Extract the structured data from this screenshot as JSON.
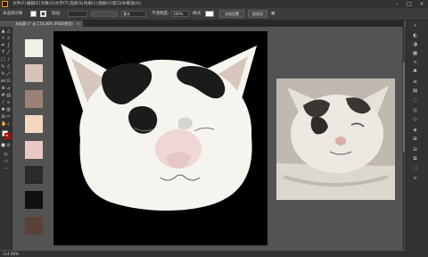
{
  "menubar": {
    "items": [
      "文件(F)",
      "编辑(E)",
      "对象(O)",
      "文字(T)",
      "选择(S)",
      "效果(C)",
      "视图(V)",
      "窗口(W)",
      "帮助(H)"
    ]
  },
  "control_bar": {
    "path_label": "未选择对象",
    "stroke_label": "描边:",
    "basic_label": "基本",
    "opacity_label": "不透明度:",
    "opacity_value": "100%",
    "style_label": "样式:",
    "doc_setup_label": "文档设置",
    "prefs_label": "首选项"
  },
  "document_tab": {
    "label": "未标题-1* @ 114.46% (RGB/预览)",
    "close": "×"
  },
  "status_bar": {
    "zoom": "114.46%"
  },
  "colors": {
    "swatches": [
      "#f2efe9",
      "#d8c3b7",
      "#9b8276",
      "#f3d8bd",
      "#e8c7c4",
      "#2a2a2a",
      "#111111",
      "#5a4236"
    ],
    "cat_face": "#f6f4ee",
    "cat_patch": "#1b1b1b",
    "ear_inner": "#d7c6bc",
    "blush": "#e9c0c4",
    "nose": "#e6c7c9"
  },
  "icons": {
    "tools": [
      "select-icon",
      "direct-select-icon",
      "magic-wand-icon",
      "pen-icon",
      "type-icon",
      "line-icon",
      "rectangle-icon",
      "brush-icon",
      "pencil-icon",
      "eraser-icon",
      "rotate-icon",
      "scale-icon",
      "width-icon",
      "free-transform-icon",
      "shape-builder-icon",
      "perspective-icon",
      "mesh-icon",
      "gradient-icon",
      "eyedropper-icon",
      "blend-icon",
      "symbol-sprayer-icon",
      "graph-icon",
      "artboard-icon",
      "slice-icon",
      "hand-icon",
      "zoom-icon"
    ],
    "dock": [
      "color-icon",
      "color-guide-icon",
      "swatches-icon",
      "brushes-icon",
      "symbols-icon",
      "stroke-icon",
      "gradient-panel-icon",
      "transparency-icon",
      "appearance-icon",
      "graphic-styles-icon",
      "layers-icon",
      "artboards-icon",
      "align-icon",
      "pathfinder-icon",
      "transform-icon",
      "links-icon"
    ]
  }
}
